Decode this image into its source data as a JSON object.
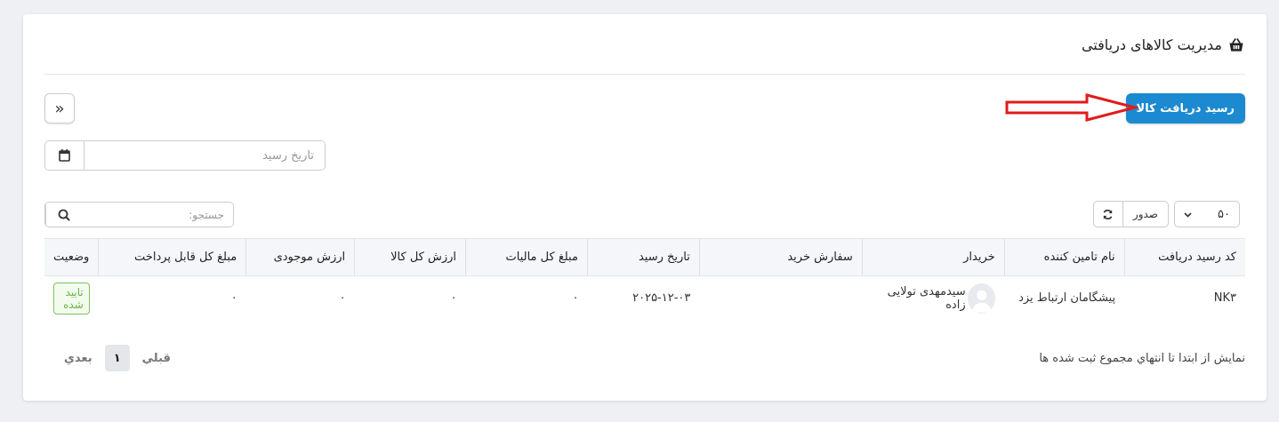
{
  "header": {
    "title": "مدیریت کالاهای دریافتی",
    "icon": "basket-icon"
  },
  "actions": {
    "primary_label": "رسید دریافت کالا",
    "collapse_icon": "»"
  },
  "filters": {
    "date_placeholder": "تاریخ رسید"
  },
  "search": {
    "placeholder": "جستجو:"
  },
  "toolbar": {
    "export_label": "صدور",
    "page_size": "۵۰"
  },
  "table": {
    "columns": [
      "کد رسید دریافت",
      "نام تامین کننده",
      "خریدار",
      "سفارش خرید",
      "تاریخ رسید",
      "مبلغ کل مالیات",
      "ارزش کل کالا",
      "ارزش موجودی",
      "مبلغ کل قابل پرداخت",
      "وضعیت"
    ],
    "rows": [
      {
        "code": "NK۳",
        "supplier": "پیشگامان ارتباط یزد",
        "buyer": "سیدمهدی تولایی زاده",
        "order": "",
        "date": "۲۰۲۵-۱۲-۰۳",
        "tax": "۰",
        "goods_value": "۰",
        "stock_value": "۰",
        "payable": "۰",
        "status": "تایید شده"
      }
    ]
  },
  "footer": {
    "info": "نمایش از ابتدا تا انتهاي مجموع ثبت شده ها"
  },
  "pagination": {
    "prev": "قبلي",
    "page": "۱",
    "next": "بعدي"
  },
  "colors": {
    "primary": "#1c8ad1",
    "arrow": "#e11b1b",
    "success": "#6bb34a"
  }
}
